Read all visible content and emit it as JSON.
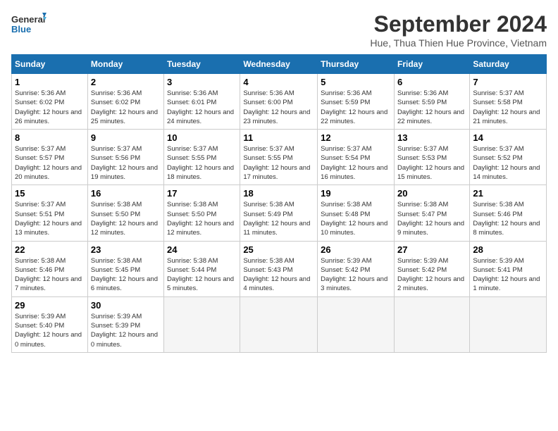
{
  "logo": {
    "line1": "General",
    "line2": "Blue"
  },
  "title": "September 2024",
  "subtitle": "Hue, Thua Thien Hue Province, Vietnam",
  "weekdays": [
    "Sunday",
    "Monday",
    "Tuesday",
    "Wednesday",
    "Thursday",
    "Friday",
    "Saturday"
  ],
  "weeks": [
    [
      {
        "day": "1",
        "sunrise": "5:36 AM",
        "sunset": "6:02 PM",
        "daylight": "12 hours and 26 minutes."
      },
      {
        "day": "2",
        "sunrise": "5:36 AM",
        "sunset": "6:02 PM",
        "daylight": "12 hours and 25 minutes."
      },
      {
        "day": "3",
        "sunrise": "5:36 AM",
        "sunset": "6:01 PM",
        "daylight": "12 hours and 24 minutes."
      },
      {
        "day": "4",
        "sunrise": "5:36 AM",
        "sunset": "6:00 PM",
        "daylight": "12 hours and 23 minutes."
      },
      {
        "day": "5",
        "sunrise": "5:36 AM",
        "sunset": "5:59 PM",
        "daylight": "12 hours and 22 minutes."
      },
      {
        "day": "6",
        "sunrise": "5:36 AM",
        "sunset": "5:59 PM",
        "daylight": "12 hours and 22 minutes."
      },
      {
        "day": "7",
        "sunrise": "5:37 AM",
        "sunset": "5:58 PM",
        "daylight": "12 hours and 21 minutes."
      }
    ],
    [
      {
        "day": "8",
        "sunrise": "5:37 AM",
        "sunset": "5:57 PM",
        "daylight": "12 hours and 20 minutes."
      },
      {
        "day": "9",
        "sunrise": "5:37 AM",
        "sunset": "5:56 PM",
        "daylight": "12 hours and 19 minutes."
      },
      {
        "day": "10",
        "sunrise": "5:37 AM",
        "sunset": "5:55 PM",
        "daylight": "12 hours and 18 minutes."
      },
      {
        "day": "11",
        "sunrise": "5:37 AM",
        "sunset": "5:55 PM",
        "daylight": "12 hours and 17 minutes."
      },
      {
        "day": "12",
        "sunrise": "5:37 AM",
        "sunset": "5:54 PM",
        "daylight": "12 hours and 16 minutes."
      },
      {
        "day": "13",
        "sunrise": "5:37 AM",
        "sunset": "5:53 PM",
        "daylight": "12 hours and 15 minutes."
      },
      {
        "day": "14",
        "sunrise": "5:37 AM",
        "sunset": "5:52 PM",
        "daylight": "12 hours and 14 minutes."
      }
    ],
    [
      {
        "day": "15",
        "sunrise": "5:37 AM",
        "sunset": "5:51 PM",
        "daylight": "12 hours and 13 minutes."
      },
      {
        "day": "16",
        "sunrise": "5:38 AM",
        "sunset": "5:50 PM",
        "daylight": "12 hours and 12 minutes."
      },
      {
        "day": "17",
        "sunrise": "5:38 AM",
        "sunset": "5:50 PM",
        "daylight": "12 hours and 12 minutes."
      },
      {
        "day": "18",
        "sunrise": "5:38 AM",
        "sunset": "5:49 PM",
        "daylight": "12 hours and 11 minutes."
      },
      {
        "day": "19",
        "sunrise": "5:38 AM",
        "sunset": "5:48 PM",
        "daylight": "12 hours and 10 minutes."
      },
      {
        "day": "20",
        "sunrise": "5:38 AM",
        "sunset": "5:47 PM",
        "daylight": "12 hours and 9 minutes."
      },
      {
        "day": "21",
        "sunrise": "5:38 AM",
        "sunset": "5:46 PM",
        "daylight": "12 hours and 8 minutes."
      }
    ],
    [
      {
        "day": "22",
        "sunrise": "5:38 AM",
        "sunset": "5:46 PM",
        "daylight": "12 hours and 7 minutes."
      },
      {
        "day": "23",
        "sunrise": "5:38 AM",
        "sunset": "5:45 PM",
        "daylight": "12 hours and 6 minutes."
      },
      {
        "day": "24",
        "sunrise": "5:38 AM",
        "sunset": "5:44 PM",
        "daylight": "12 hours and 5 minutes."
      },
      {
        "day": "25",
        "sunrise": "5:38 AM",
        "sunset": "5:43 PM",
        "daylight": "12 hours and 4 minutes."
      },
      {
        "day": "26",
        "sunrise": "5:39 AM",
        "sunset": "5:42 PM",
        "daylight": "12 hours and 3 minutes."
      },
      {
        "day": "27",
        "sunrise": "5:39 AM",
        "sunset": "5:42 PM",
        "daylight": "12 hours and 2 minutes."
      },
      {
        "day": "28",
        "sunrise": "5:39 AM",
        "sunset": "5:41 PM",
        "daylight": "12 hours and 1 minute."
      }
    ],
    [
      {
        "day": "29",
        "sunrise": "5:39 AM",
        "sunset": "5:40 PM",
        "daylight": "12 hours and 0 minutes."
      },
      {
        "day": "30",
        "sunrise": "5:39 AM",
        "sunset": "5:39 PM",
        "daylight": "12 hours and 0 minutes."
      },
      null,
      null,
      null,
      null,
      null
    ]
  ]
}
